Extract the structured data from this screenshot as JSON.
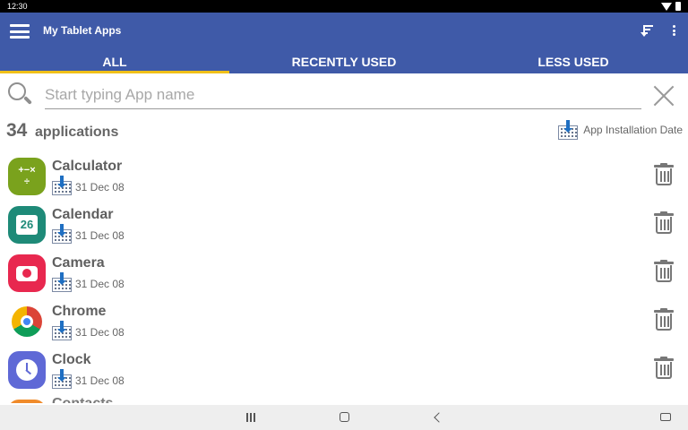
{
  "status_bar": {
    "time": "12:30",
    "icons": [
      "wifi-icon",
      "battery-icon"
    ]
  },
  "app_bar": {
    "title": "My Tablet Apps",
    "icons": [
      "menu-icon",
      "sort-icon",
      "more-options-icon"
    ],
    "color": "#3f5aa8"
  },
  "tabs": [
    {
      "label": "ALL",
      "active": true
    },
    {
      "label": "RECENTLY USED",
      "active": false
    },
    {
      "label": "LESS USED",
      "active": false
    }
  ],
  "accent_color": "#f0c01a",
  "search": {
    "placeholder": "Start typing App name",
    "value": ""
  },
  "summary": {
    "count": "34",
    "count_label": "applications",
    "sort_mode": "App Installation Date"
  },
  "apps": [
    {
      "name": "Calculator",
      "date": "31 Dec 08",
      "icon": "calculator-icon",
      "color": "#7aa21d"
    },
    {
      "name": "Calendar",
      "date": "31 Dec 08",
      "icon": "calendar-icon",
      "icon_text": "26",
      "color": "#1e8a78"
    },
    {
      "name": "Camera",
      "date": "31 Dec 08",
      "icon": "camera-icon",
      "color": "#e8284f"
    },
    {
      "name": "Chrome",
      "date": "31 Dec 08",
      "icon": "chrome-icon"
    },
    {
      "name": "Clock",
      "date": "31 Dec 08",
      "icon": "clock-icon",
      "color": "#5f69d6"
    },
    {
      "name": "Contacts",
      "date": "",
      "icon": "contacts-icon",
      "color": "#f08b2b"
    }
  ],
  "calculator_glyph": "+−×÷",
  "nav_bar": {
    "icons": [
      "recents-icon",
      "home-icon",
      "back-icon",
      "keyboard-icon"
    ]
  }
}
